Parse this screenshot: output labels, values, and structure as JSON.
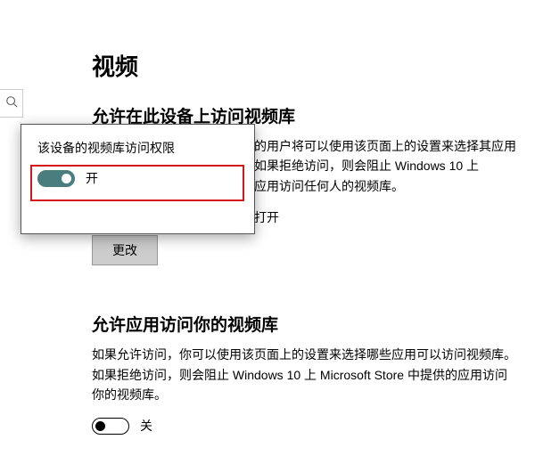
{
  "page": {
    "title": "视频",
    "section1_heading": "允许在此设备上访问视频库",
    "section1_desc": "如果允许访问，则使用此设备的用户将可以使用该页面上的设置来选择其应用是否拥有视频库的访问权限。如果拒绝访问，则会阻止 Windows 10 上 Microsoft Store 中提供的所有应用访问任何人的视频库。",
    "status_line": "此设备上的视频库访问权限已打开",
    "change_button": "更改",
    "section2_heading": "允许应用访问你的视频库",
    "section2_desc": "如果允许访问，你可以使用该页面上的设置来选择哪些应用可以访问视频库。如果拒绝访问，则会阻止 Windows 10 上 Microsoft Store 中提供的应用访问你的视频库。",
    "app_toggle_label": "关"
  },
  "popup": {
    "title": "该设备的视频库访问权限",
    "toggle_label": "开"
  },
  "icons": {
    "search": "search-icon"
  }
}
